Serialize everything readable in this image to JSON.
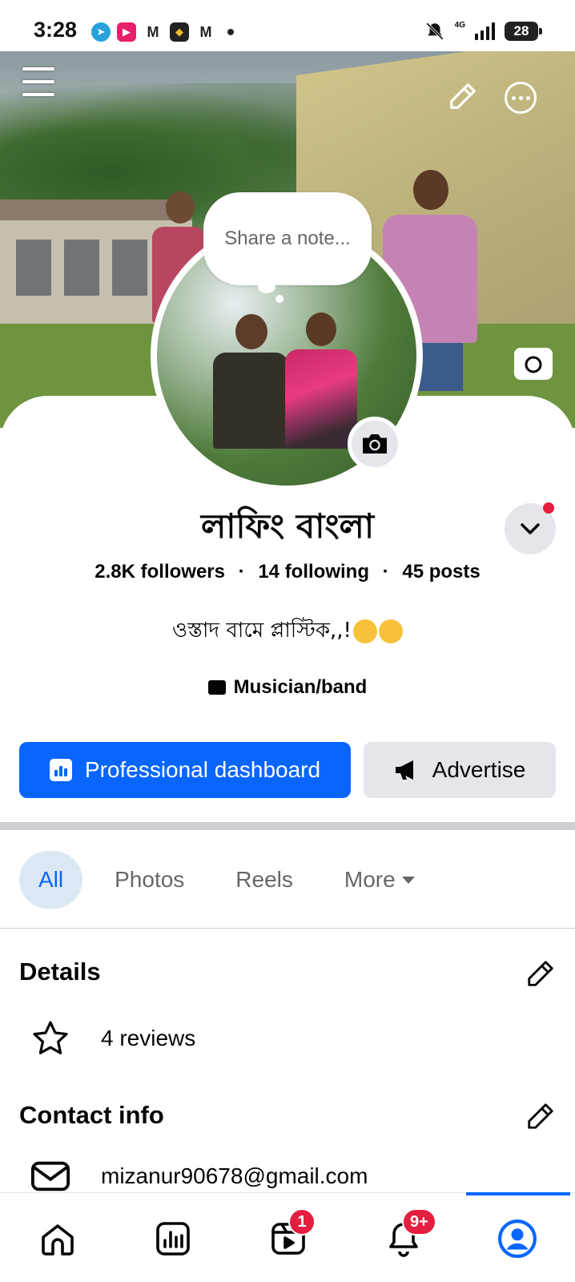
{
  "status_bar": {
    "time": "3:28",
    "network": "4G",
    "battery": "28",
    "notification_icons": [
      "telegram-icon",
      "youtube-icon",
      "gmail-icon",
      "binance-icon",
      "gmail-icon"
    ]
  },
  "cover": {
    "menu_icon": "hamburger-menu-icon",
    "edit_icon": "pencil-icon",
    "more_icon": "more-options-icon",
    "camera_icon": "camera-icon"
  },
  "note": {
    "placeholder": "Share a note..."
  },
  "profile": {
    "name": "লাফিং বাংলা",
    "followers": "2.8K followers",
    "following": "14 following",
    "posts": "45 posts",
    "separator": "·",
    "bio": "ওস্তাদ বামে প্লাস্টিক,,!",
    "category": "Musician/band"
  },
  "actions": {
    "primary_label": "Professional dashboard",
    "secondary_label": "Advertise"
  },
  "tabs": [
    {
      "label": "All",
      "active": true
    },
    {
      "label": "Photos",
      "active": false
    },
    {
      "label": "Reels",
      "active": false
    },
    {
      "label": "More",
      "active": false
    }
  ],
  "details": {
    "title": "Details",
    "reviews": "4 reviews"
  },
  "contact": {
    "title": "Contact info",
    "email": "mizanur90678@gmail.com"
  },
  "bottom_nav": {
    "reels_badge": "1",
    "notifications_badge": "9+"
  },
  "colors": {
    "accent": "#0866ff",
    "badge": "#e41e3f",
    "secondary_button": "#e4e6eb"
  }
}
